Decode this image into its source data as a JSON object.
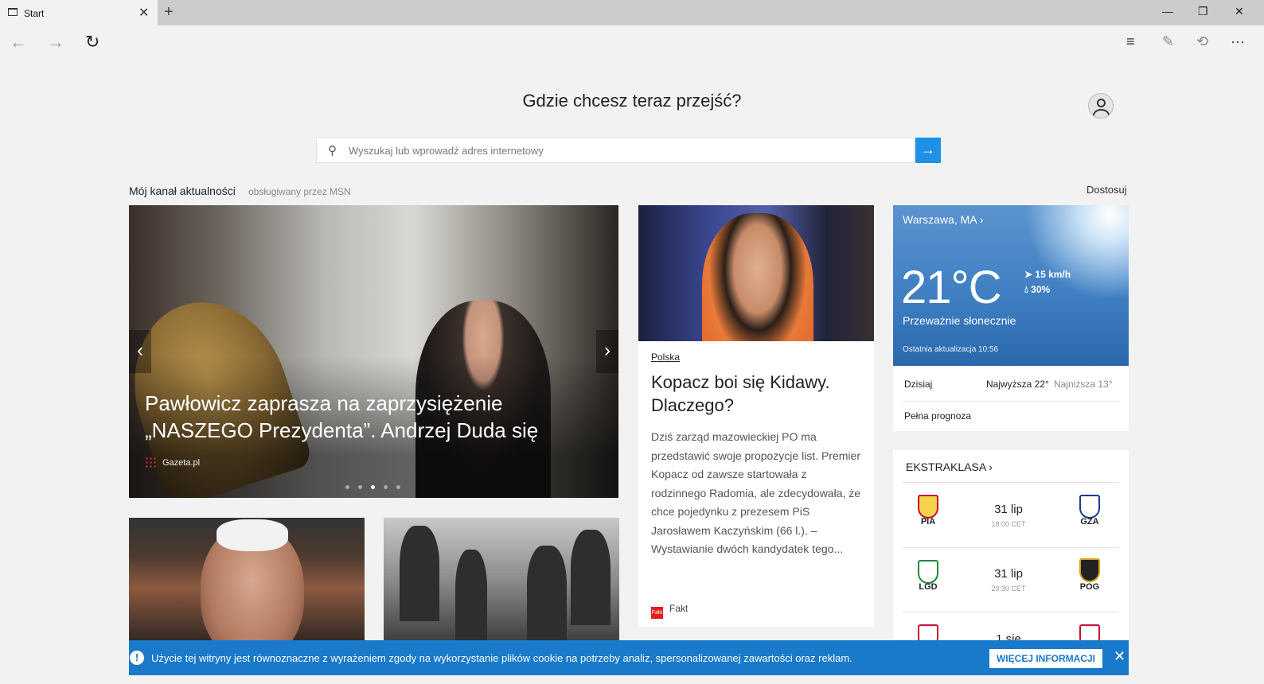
{
  "browser": {
    "tab": {
      "title": "Start",
      "close_glyph": "✕",
      "icon": "page-icon"
    },
    "new_tab_glyph": "+",
    "window": {
      "minimize": "—",
      "restore": "❐",
      "close": "✕"
    },
    "nav": {
      "back": "←",
      "forward": "→",
      "refresh": "↻"
    },
    "toolbar": {
      "hub": "≡",
      "note": "✎",
      "share": "⟲",
      "more": "···"
    }
  },
  "start": {
    "heading": "Gdzie chcesz teraz przejść?",
    "search": {
      "placeholder": "Wyszukaj lub wprowadź adres internetowy",
      "go": "→"
    },
    "feed": {
      "title": "Mój kanał aktualności",
      "subtitle": "obsługiwany przez MSN",
      "customize": "Dostosuj"
    }
  },
  "hero": {
    "title": "Pawłowicz zaprasza na zaprzysiężenie „NASZEGO Prezydenta”. Andrzej Duda się",
    "source": "Gazeta.pl",
    "prev": "‹",
    "next": "›",
    "slide_count": 5,
    "active_slide": 3
  },
  "article": {
    "category": "Polska",
    "title": "Kopacz boi się Kidawy. Dlaczego?",
    "text": "Dziś zarząd mazowieckiej PO ma przedstawić swoje propozycje list. Premier Kopacz od zawsze startowała z rodzinnego Radomia, ale zdecydowała, że chce pojedynku z prezesem PiS Jarosławem Kaczyńskim (66 l.). – Wystawianie dwóch kandydatek tego...",
    "source": "Fakt",
    "source_icon": "Fakt"
  },
  "weather": {
    "city": "Warszawa, MA ›",
    "temp": "21°C",
    "wind": "15 km/h",
    "humidity": "30%",
    "condition": "Przeważnie słonecznie",
    "updated": "Ostatnia aktualizacja 10:56",
    "today_label": "Dzisiaj",
    "high": "Najwyższa 22°",
    "low": "Najniższa 13°",
    "forecast_link": "Pełna prognoza"
  },
  "league": {
    "title": "EKSTRAKLASA ›",
    "matches": [
      {
        "home": "PIA",
        "away": "GZA",
        "date": "31 lip",
        "time": "18:00 CET",
        "home_color": "#c8102e",
        "away_color": "#1a3a8f"
      },
      {
        "home": "LGD",
        "away": "POG",
        "date": "31 lip",
        "time": "20:30 CET",
        "home_color": "#1f8a3b",
        "away_color": "#d4a017"
      },
      {
        "home": "",
        "away": "",
        "date": "1 sie",
        "time": "",
        "home_color": "#c8102e",
        "away_color": "#c8102e"
      }
    ]
  },
  "cookie": {
    "icon": "!",
    "text": "Użycie tej witryny jest równoznaczne z wyrażeniem zgody na wykorzystanie plików cookie na potrzeby analiz, spersonalizowanej zawartości oraz reklam.",
    "button": "WIĘCEJ INFORMACJI",
    "close": "✕"
  },
  "colors": {
    "accent": "#1979ca",
    "search_go": "#1e90e6"
  }
}
